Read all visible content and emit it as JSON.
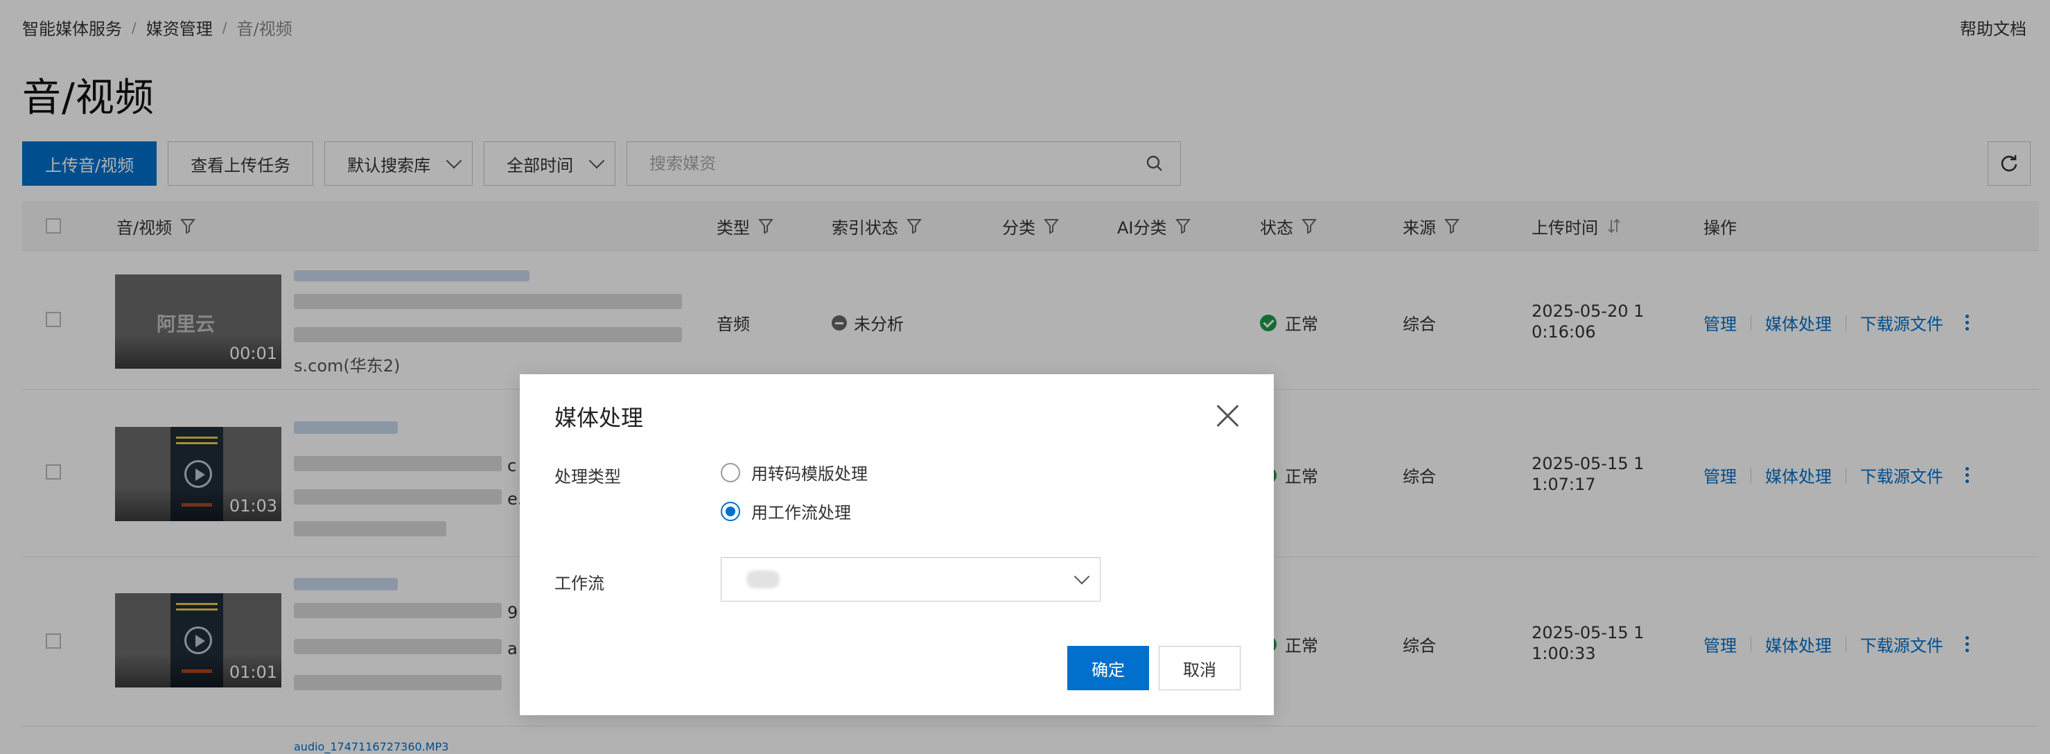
{
  "breadcrumb": {
    "items": [
      "智能媒体服务",
      "媒资管理"
    ],
    "current": "音/视频",
    "sep": "/"
  },
  "help_link": "帮助文档",
  "page_title": "音/视频",
  "toolbar": {
    "upload_label": "上传音/视频",
    "tasks_label": "查看上传任务",
    "library_select": "默认搜索库",
    "time_select": "全部时间",
    "search_placeholder": "搜索媒资"
  },
  "table": {
    "headers": {
      "media": "音/视频",
      "type": "类型",
      "index_status": "索引状态",
      "category": "分类",
      "ai_category": "AI分类",
      "status": "状态",
      "source": "来源",
      "upload_time": "上传时间",
      "actions": "操作"
    },
    "rows": [
      {
        "duration": "00:01",
        "name_tail": "s.com(华东2)",
        "type": "音频",
        "index_status": "未分析",
        "status": "正常",
        "source": "综合",
        "time_line1": "2025-05-20 1",
        "time_line2": "0:16:06"
      },
      {
        "duration": "01:03",
        "name_frag1": "c",
        "name_frag2": "e.c",
        "status": "正常",
        "source": "综合",
        "time_line1": "2025-05-15 1",
        "time_line2": "1:07:17"
      },
      {
        "duration": "01:01",
        "name_frag1": "9",
        "name_frag2": "a",
        "status": "正常",
        "source": "综合",
        "time_line1": "2025-05-15 1",
        "time_line2": "1:00:33"
      }
    ],
    "next_row_name": "audio_1747116727360.MP3",
    "actions": {
      "manage": "管理",
      "process": "媒体处理",
      "download": "下载源文件"
    },
    "thumb_watermark": "阿里云"
  },
  "modal": {
    "title": "媒体处理",
    "process_type_label": "处理类型",
    "options": [
      "用转码模版处理",
      "用工作流处理"
    ],
    "selected_option": "用工作流处理",
    "workflow_label": "工作流",
    "confirm_label": "确定",
    "cancel_label": "取消"
  },
  "colors": {
    "primary": "#0070cc",
    "success": "#1a9c4a",
    "overlay": "rgba(0,0,0,0.30)"
  }
}
